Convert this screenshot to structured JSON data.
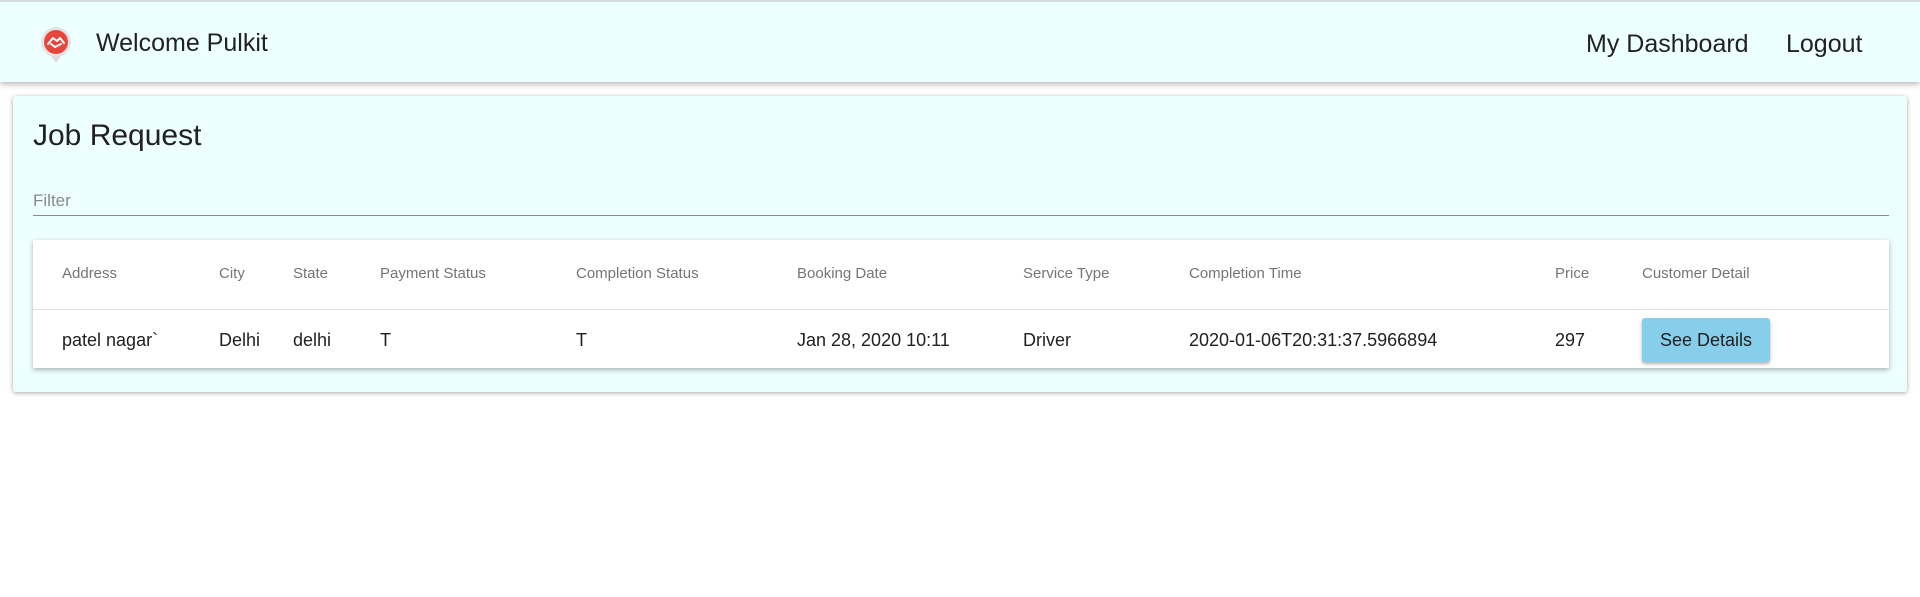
{
  "header": {
    "logo_icon": "handshake-pin-icon",
    "welcome_text": "Welcome Pulkit",
    "nav": {
      "dashboard_label": "My Dashboard",
      "logout_label": "Logout"
    }
  },
  "main": {
    "title": "Job Request",
    "filter": {
      "placeholder": "Filter",
      "value": ""
    },
    "table": {
      "columns": [
        "Address",
        "City",
        "State",
        "Payment Status",
        "Completion Status",
        "Booking Date",
        "Service Type",
        "Completion Time",
        "Price",
        "Customer Detail"
      ],
      "rows": [
        {
          "address": "patel nagar`",
          "city": "Delhi",
          "state": "delhi",
          "payment_status": "T",
          "completion_status": "T",
          "booking_date": "Jan 28, 2020 10:11",
          "service_type": "Driver",
          "completion_time": "2020-01-06T20:31:37.5966894",
          "price": "297",
          "action_label": "See Details"
        }
      ]
    }
  },
  "colors": {
    "header_bg": "#eeffff",
    "card_bg": "#eeffff",
    "button_bg": "#87ceeb",
    "logo_red": "#e8453c"
  }
}
